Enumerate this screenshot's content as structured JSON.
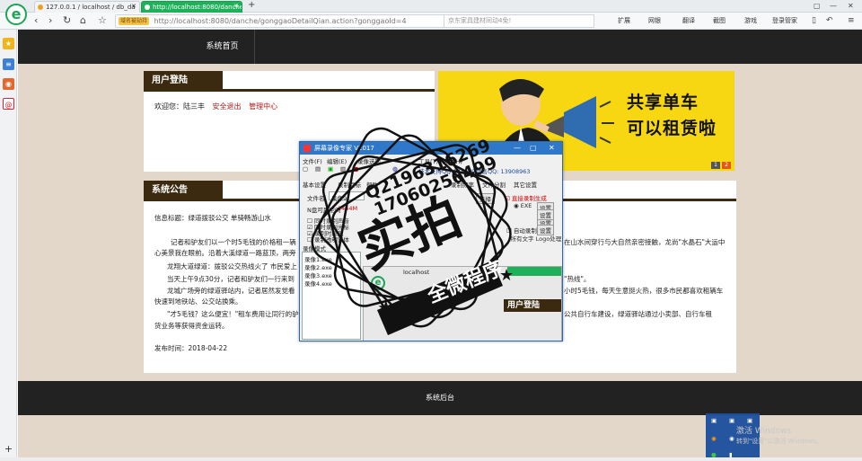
{
  "browser": {
    "tabs": [
      {
        "label": "127.0.0.1 / localhost / db_da"
      },
      {
        "label": "http://localhost:8080/danche/"
      }
    ],
    "new_tab_label": "+",
    "nav": {
      "back": "‹",
      "forward": "›",
      "reload": "↻",
      "home": "⌂",
      "star": "☆"
    },
    "url_badge": "域名被劫持",
    "url": "http://localhost:8080/danche/gonggaoDetailQian.action?gonggaoId=4",
    "search_placeholder": "京东家具建材同动4免!",
    "tools": [
      "扩展",
      "网银",
      "翻译",
      "截图",
      "游戏",
      "登录管家"
    ],
    "sidebar_add": "+"
  },
  "site": {
    "nav_home": "系统首页",
    "login": {
      "title": "用户登陆",
      "welcome": "欢迎您：陆三丰",
      "logout": "安全退出",
      "admin": "管理中心"
    },
    "banner": {
      "line1": "共享单车",
      "line2": "可以租赁啦",
      "pages": [
        "1",
        "2"
      ]
    },
    "notice": {
      "title": "系统公告",
      "info_title": "信息标题：绿道拨驳公交 单骑畅游山水",
      "paragraphs": [
        "记者和驴友们以一个时5毛钱的价格租一辆",
        "心美景我在眼前。沿着大溪绿道一路蓝顶，两旁",
        "龙翔大道绿道：拨驳公交热线火了 市民爱上",
        "当天上午9点30分，记者和驴友们一行来到",
        "龙城广场旁的绿道驿站内，记者居然发觉看",
        "快速到地铁站、公交站换乘。",
        "\"才5毛钱？这么便宜！\"租车费用让同行的驴",
        "货业务等获得资金运转。"
      ],
      "right_fragments": [
        "在山水间穿行与大自然亲密接触，龙尚\"水晶石\"大运中",
        "\"热线\"。",
        "小时5毛钱，每天生意挺火热，很多市民都喜欢租辆车",
        "公共自行车建设，绿道驿站通过小卖部、自行车租"
      ],
      "publish_time": "发布时间：2018-04-22"
    },
    "footer": "系统后台"
  },
  "recorder": {
    "title": "屏幕录像专家 V2017",
    "menu": [
      "文件(F)",
      "编辑(E)",
      "录像选项",
      "工具(T)",
      "帮助(H)"
    ],
    "tech": "技术支持QQ:183939",
    "sales": "销售QQ: 13908963",
    "tabs": [
      "基本设置",
      "帮助",
      "录制目标",
      "录制频率",
      "文件分割",
      "其它设置"
    ],
    "file_label": "文件名:",
    "file_value": "录像9",
    "disk_label": "N盘可用空间",
    "disk_value": "1444M",
    "checks": [
      "同时录制声音",
      "同时录制光标",
      "录制时隐藏",
      "录制透明窗体"
    ],
    "mode_label": "录像模式",
    "list": [
      "录像1.exe",
      "录像2.exe",
      "录像3.exe",
      "录像4.exe"
    ],
    "right_opts": [
      "直接录制生成",
      "EXE",
      "设置",
      "设置",
      "设置",
      "自动录制"
    ],
    "setting_btn": "设置",
    "select_btn": "选择",
    "status": "(所有文字 Logo处理)"
  },
  "watermark": {
    "qq1": "Q2196316269",
    "qq2": "17060256499",
    "big": "实拍",
    "ribbon": "全微程序",
    "shot_login": "用户登陆",
    "shot_url": "localhost"
  },
  "windows": {
    "activate": "激活 Windows",
    "activate_sub": "转到\"设置\"以激活 Windows。"
  }
}
